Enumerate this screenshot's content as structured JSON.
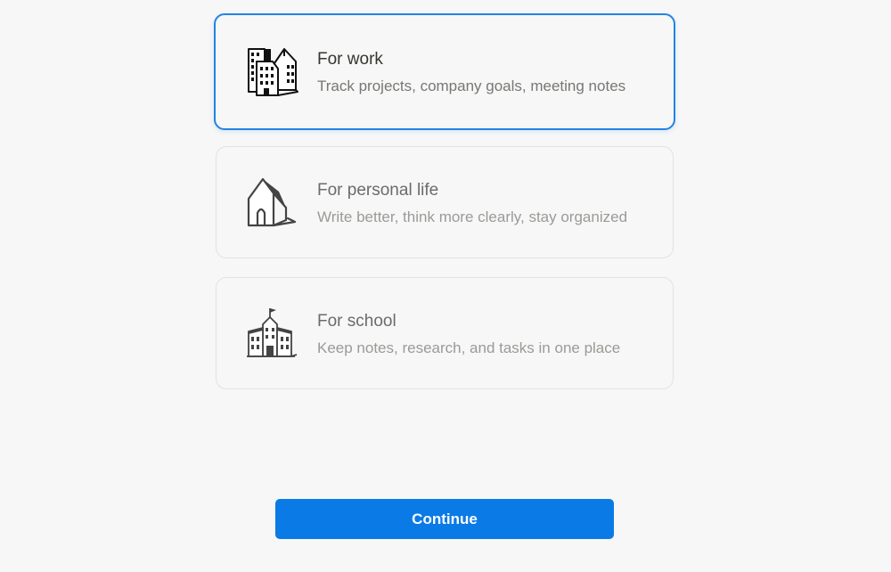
{
  "options": [
    {
      "title": "For work",
      "description": "Track projects, company goals, meeting notes",
      "icon": "office-buildings-icon",
      "selected": true
    },
    {
      "title": "For personal life",
      "description": "Write better, think more clearly, stay organized",
      "icon": "house-icon",
      "selected": false
    },
    {
      "title": "For school",
      "description": "Keep notes, research, and tasks in one place",
      "icon": "school-building-icon",
      "selected": false
    }
  ],
  "continue_label": "Continue",
  "colors": {
    "accent": "#2383e2",
    "button": "#0a7ae6",
    "background": "#f7f7f7"
  }
}
